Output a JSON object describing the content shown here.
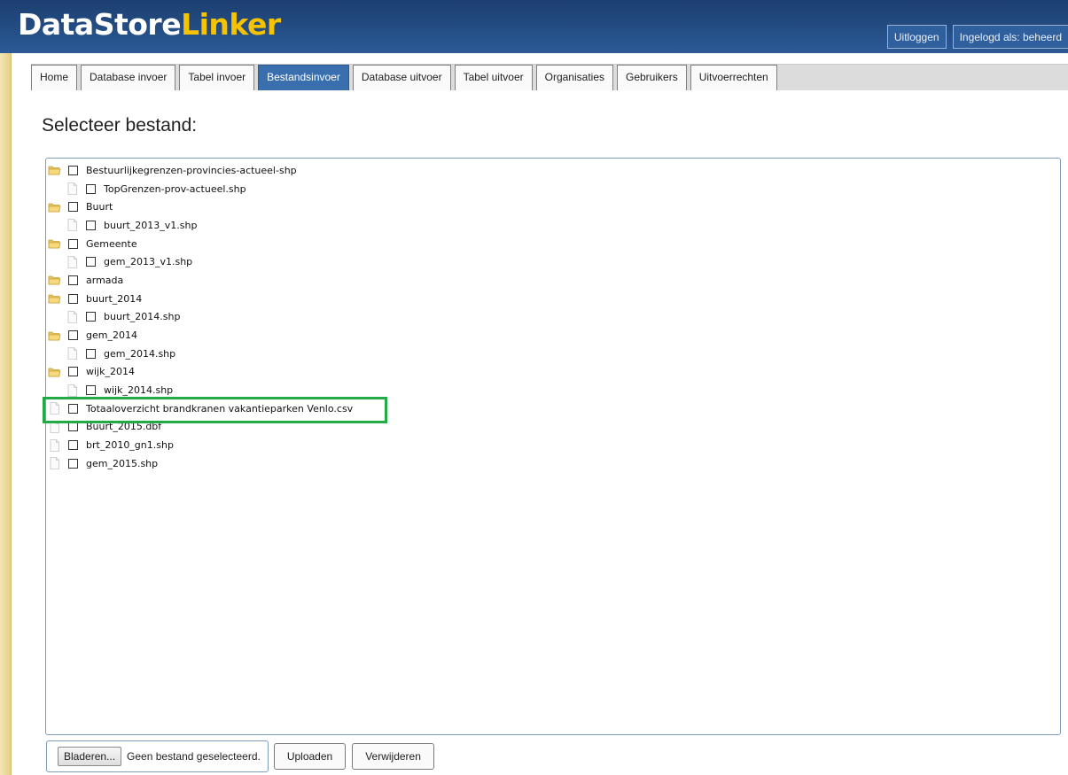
{
  "app": {
    "logo_part1": "DataStore",
    "logo_part2": "Linker",
    "logout_label": "Uitloggen",
    "logged_in_label": "Ingelogd als: beheerd"
  },
  "tabs": [
    {
      "label": "Home",
      "active": false
    },
    {
      "label": "Database invoer",
      "active": false
    },
    {
      "label": "Tabel invoer",
      "active": false
    },
    {
      "label": "Bestandsinvoer",
      "active": true
    },
    {
      "label": "Database uitvoer",
      "active": false
    },
    {
      "label": "Tabel uitvoer",
      "active": false
    },
    {
      "label": "Organisaties",
      "active": false
    },
    {
      "label": "Gebruikers",
      "active": false
    },
    {
      "label": "Uitvoerrechten",
      "active": false
    }
  ],
  "page_title": "Selecteer bestand:",
  "tree": [
    {
      "label": "Bestuurlijkegrenzen-provincies-actueel-shp",
      "type": "folder",
      "level": 0
    },
    {
      "label": "TopGrenzen-prov-actueel.shp",
      "type": "file",
      "level": 1
    },
    {
      "label": "Buurt",
      "type": "folder",
      "level": 0
    },
    {
      "label": "buurt_2013_v1.shp",
      "type": "file",
      "level": 1
    },
    {
      "label": "Gemeente",
      "type": "folder",
      "level": 0
    },
    {
      "label": "gem_2013_v1.shp",
      "type": "file",
      "level": 1
    },
    {
      "label": "armada",
      "type": "folder",
      "level": 0
    },
    {
      "label": "buurt_2014",
      "type": "folder",
      "level": 0
    },
    {
      "label": "buurt_2014.shp",
      "type": "file",
      "level": 1
    },
    {
      "label": "gem_2014",
      "type": "folder",
      "level": 0
    },
    {
      "label": "gem_2014.shp",
      "type": "file",
      "level": 1
    },
    {
      "label": "wijk_2014",
      "type": "folder",
      "level": 0
    },
    {
      "label": "wijk_2014.shp",
      "type": "file",
      "level": 1
    },
    {
      "label": "Totaaloverzicht brandkranen vakantieparken Venlo.csv",
      "type": "file",
      "level": 0
    },
    {
      "label": "Buurt_2015.dbf",
      "type": "file",
      "level": 0
    },
    {
      "label": "brt_2010_gn1.shp",
      "type": "file",
      "level": 0
    },
    {
      "label": "gem_2015.shp",
      "type": "file",
      "level": 0
    }
  ],
  "highlight_color": "#22aa44",
  "file_input": {
    "browse_label": "Bladeren...",
    "status": "Geen bestand geselecteerd."
  },
  "buttons": {
    "upload_label": "Uploaden",
    "delete_label": "Verwijderen"
  },
  "colors": {
    "header_bg": "#244d84",
    "active_tab": "#3a6fae",
    "logo_accent": "#f7c300"
  }
}
